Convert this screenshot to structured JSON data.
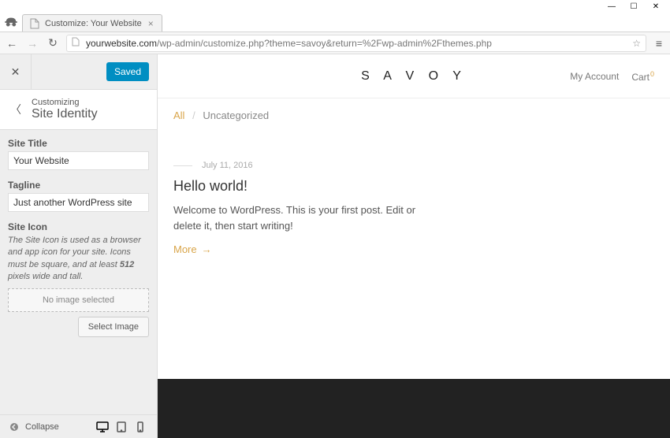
{
  "browser": {
    "tab_title": "Customize: Your Website",
    "url_domain": "yourwebsite.com",
    "url_path": "/wp-admin/customize.php?theme=savoy&return=%2Fwp-admin%2Fthemes.php"
  },
  "customizer": {
    "saved_label": "Saved",
    "customizing_label": "Customizing",
    "section_title": "Site Identity",
    "site_title": {
      "label": "Site Title",
      "value": "Your Website"
    },
    "tagline": {
      "label": "Tagline",
      "value": "Just another WordPress site"
    },
    "site_icon": {
      "label": "Site Icon",
      "description_prefix": "The Site Icon is used as a browser and app icon for your site. Icons must be square, and at least ",
      "description_bold": "512",
      "description_suffix": " pixels wide and tall.",
      "placeholder": "No image selected",
      "button": "Select Image"
    },
    "collapse_label": "Collapse"
  },
  "preview": {
    "logo": "S A V O Y",
    "header": {
      "account_label": "My Account",
      "cart_label": "Cart",
      "cart_count": "0"
    },
    "breadcrumb": {
      "all": "All",
      "separator": "/",
      "category": "Uncategorized"
    },
    "post": {
      "date": "July 11, 2016",
      "title": "Hello world!",
      "excerpt": "Welcome to WordPress. This is your first post. Edit or delete it, then start writing!",
      "more_label": "More",
      "more_arrow": "→"
    }
  }
}
